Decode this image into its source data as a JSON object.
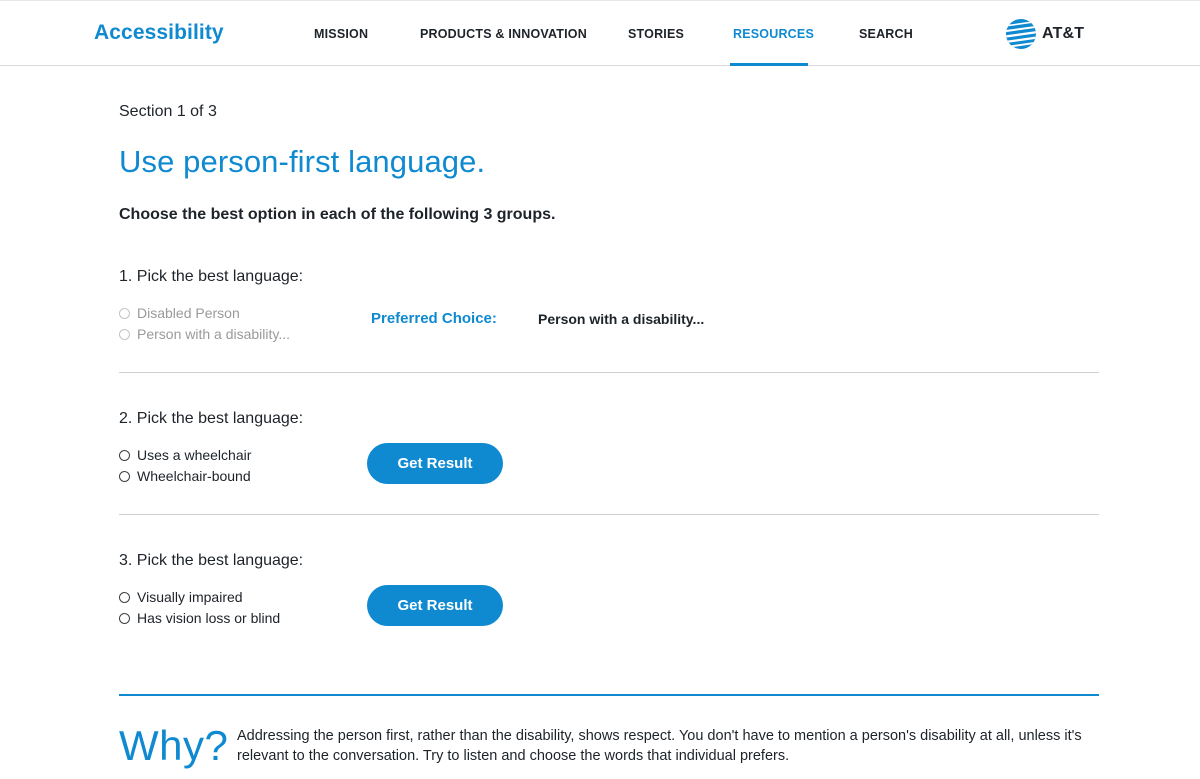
{
  "header": {
    "brand": "Accessibility",
    "nav": [
      "MISSION",
      "PRODUCTS & INNOVATION",
      "STORIES",
      "RESOURCES",
      "SEARCH"
    ],
    "active_nav": "RESOURCES",
    "logo_text": "AT&T",
    "logo_icon": "att-globe-icon",
    "accent_color": "#0f8ad1"
  },
  "main": {
    "section_count": "Section 1 of 3",
    "title": "Use person-first language.",
    "instructions": "Choose the best option in each of the following 3 groups.",
    "groups": [
      {
        "question": "1. Pick the best language:",
        "options": [
          "Disabled Person",
          "Person with a disability..."
        ],
        "state": "answered",
        "preferred_label": "Preferred Choice:",
        "preferred_value": "Person with a disability..."
      },
      {
        "question": "2. Pick the best language:",
        "options": [
          "Uses a wheelchair",
          "Wheelchair-bound"
        ],
        "state": "unanswered",
        "button_label": "Get Result"
      },
      {
        "question": "3. Pick the best language:",
        "options": [
          "Visually impaired",
          "Has vision loss or blind"
        ],
        "state": "unanswered",
        "button_label": "Get Result"
      }
    ]
  },
  "why": {
    "heading": "Why?",
    "text": "Addressing the person first, rather than the disability, shows respect.  You don't have to mention a person's disability at all, unless it's relevant to the conversation. Try to listen and choose the words that individual prefers."
  }
}
